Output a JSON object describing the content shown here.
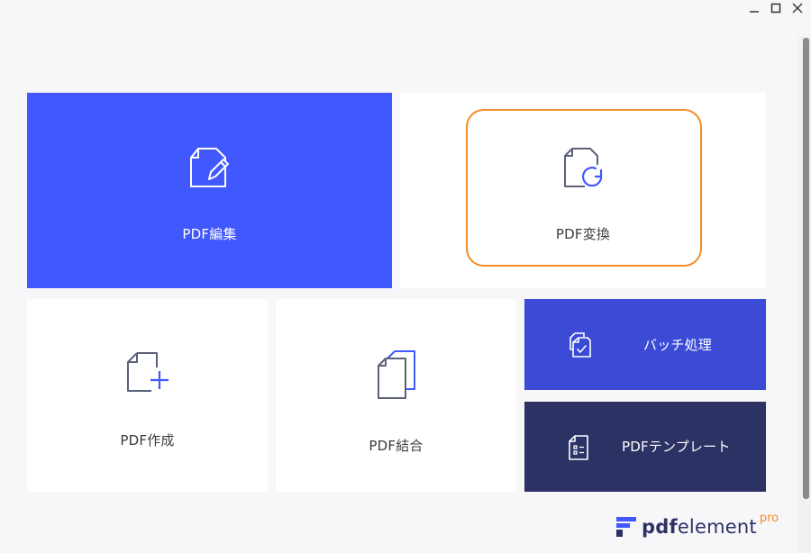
{
  "window": {
    "controls": [
      "minimize-icon",
      "maximize-icon",
      "close-icon"
    ]
  },
  "cards": {
    "edit": {
      "label": "PDF編集",
      "icon": "edit-document-icon",
      "color": "#4258ff"
    },
    "convert": {
      "label": "PDF変換",
      "icon": "convert-document-icon",
      "color": "#ffffff",
      "focused": true
    },
    "create": {
      "label": "PDF作成",
      "icon": "create-document-icon",
      "color": "#ffffff"
    },
    "combine": {
      "label": "PDF結合",
      "icon": "combine-documents-icon",
      "color": "#ffffff"
    },
    "batch": {
      "label": "バッチ処理",
      "icon": "batch-process-icon",
      "color": "#3b4bd6"
    },
    "template": {
      "label": "PDFテンプレート",
      "icon": "template-document-icon",
      "color": "#2d3265"
    }
  },
  "logo": {
    "prefix": "pdf",
    "suffix": "element",
    "badge": "pro",
    "accent": "#f28c28",
    "brand": "#2d3265"
  }
}
